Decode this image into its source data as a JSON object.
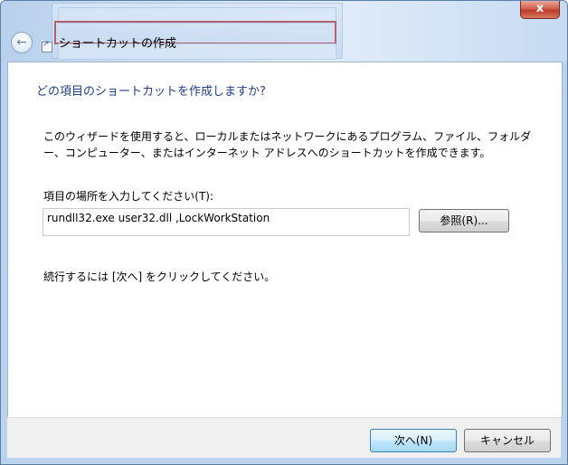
{
  "window": {
    "title": "ショートカットの作成",
    "close_symbol": "x"
  },
  "background_window": {
    "rows": [
      "",
      "",
      ""
    ]
  },
  "wizard": {
    "heading": "どの項目のショートカットを作成しますか?",
    "description": "このウィザードを使用すると、ローカルまたはネットワークにあるプログラム、ファイル、フォルダー、コンピューター、またはインターネット アドレスへのショートカットを作成できます。",
    "location_label": "項目の場所を入力してください(T):",
    "location_value": "rundll32.exe user32.dll ,LockWorkStation",
    "browse_label": "参照(R)...",
    "hint": "続行するには [次へ] をクリックしてください。"
  },
  "footer": {
    "next_label": "次へ(N)",
    "cancel_label": "キャンセル"
  },
  "icons": {
    "back": "back-arrow-icon",
    "title": "shortcut-icon",
    "close": "close-icon"
  }
}
